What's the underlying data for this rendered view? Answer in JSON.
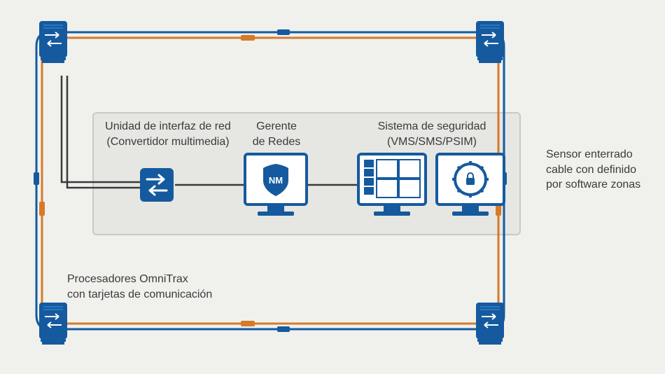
{
  "labels": {
    "niu_line1": "Unidad de interfaz de red",
    "niu_line2": "(Convertidor multimedia)",
    "nm_line1": "Gerente",
    "nm_line2": "de Redes",
    "sec_line1": "Sistema de seguridad",
    "sec_line2": "(VMS/SMS/PSIM)",
    "sensor_line1": "Sensor enterrado",
    "sensor_line2": "cable con definido",
    "sensor_line3": "por software zonas",
    "proc_line1": "Procesadores OmniTrax",
    "proc_line2": "con tarjetas de comunicación",
    "nm_badge": "NM"
  },
  "colors": {
    "blue": "#155a9e",
    "orange": "#d67a2a",
    "dark": "#3a3a3a",
    "panel": "#e6e7e3"
  }
}
